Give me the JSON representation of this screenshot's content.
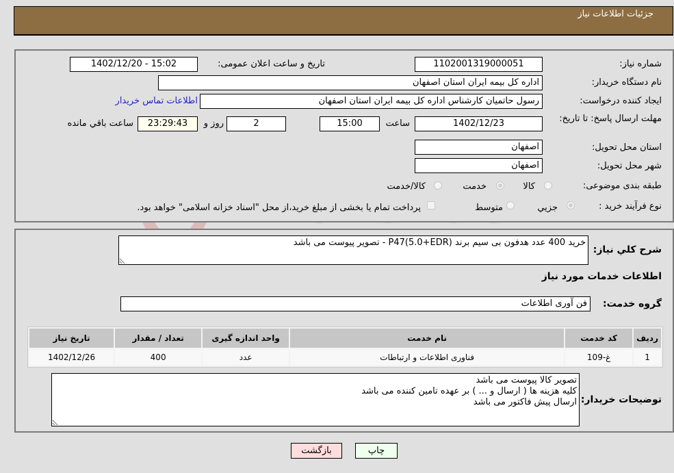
{
  "header": {
    "title": "جزئیات اطلاعات نیاز"
  },
  "details": {
    "need_number_label": "شماره نیاز:",
    "need_number": "1102001319000051",
    "announce_label": "تاریخ و ساعت اعلان عمومی:",
    "announce_value": "1402/12/20 - 15:02",
    "buyer_org_label": "نام دستگاه خریدار:",
    "buyer_org": "اداره کل بیمه ایران استان اصفهان",
    "requester_label": "ایجاد کننده درخواست:",
    "requester": "رسول  حاتمیان کارشناس اداره کل بیمه ایران استان اصفهان",
    "buyer_contact_link": "اطلاعات تماس خریدار",
    "deadline_label": "مهلت ارسال پاسخ: تا تاریخ:",
    "deadline_date": "1402/12/23",
    "time_label": "ساعت",
    "deadline_time": "15:00",
    "days_value": "2",
    "days_label": "روز و",
    "remaining_time": "23:29:43",
    "remaining_label": "ساعت باقي مانده",
    "province_label": "استان محل تحویل:",
    "province": "اصفهان",
    "city_label": "شهر محل تحویل:",
    "city": "اصفهان",
    "category_label": "طبقه بندی موضوعی:",
    "category_options": [
      {
        "label": "کالا",
        "checked": false
      },
      {
        "label": "خدمت",
        "checked": true
      },
      {
        "label": "کالا/خدمت",
        "checked": false
      }
    ],
    "process_label": "نوع فرآیند خرید :",
    "process_options": [
      {
        "label": "جزيي",
        "checked": true
      },
      {
        "label": "متوسط",
        "checked": false
      }
    ],
    "treasury_note": "پرداخت تمام یا بخشی از مبلغ خرید،از محل \"اسناد خزانه اسلامی\" خواهد بود.",
    "treasury_checked": false
  },
  "summary": {
    "description_label": "شرح کلي نياز:",
    "description": "خرید 400 عدد هدفون بی سیم برند P47(5.0+EDR) - تصویر پیوست می باشد",
    "services_heading": "اطلاعات خدمات مورد نیاز",
    "service_group_label": "گروه خدمت:",
    "service_group": "فن آوری اطلاعات"
  },
  "table": {
    "columns": [
      "ردیف",
      "کد خدمت",
      "نام خدمت",
      "واحد اندازه گیری",
      "تعداد / مقدار",
      "تاریخ نیاز"
    ],
    "rows": [
      [
        "1",
        "غ-109",
        "فناوری اطلاعات و ارتباطات",
        "عدد",
        "400",
        "1402/12/26"
      ]
    ]
  },
  "buyer_notes": {
    "label": "توضیحات خریدار:",
    "text": "تصویر کالا پیوست می باشد\nکلیه هزینه ها ( ارسال و ... ) بر عهده تامین کننده می باشد\nارسال پیش فاکتور می باشد"
  },
  "buttons": {
    "print": "چاپ",
    "back": "بازگشت"
  },
  "colors": {
    "header": "#8d6e43",
    "print_bg": "#eeffee",
    "back_bg": "#ffdddd",
    "link": "#2222cc"
  }
}
